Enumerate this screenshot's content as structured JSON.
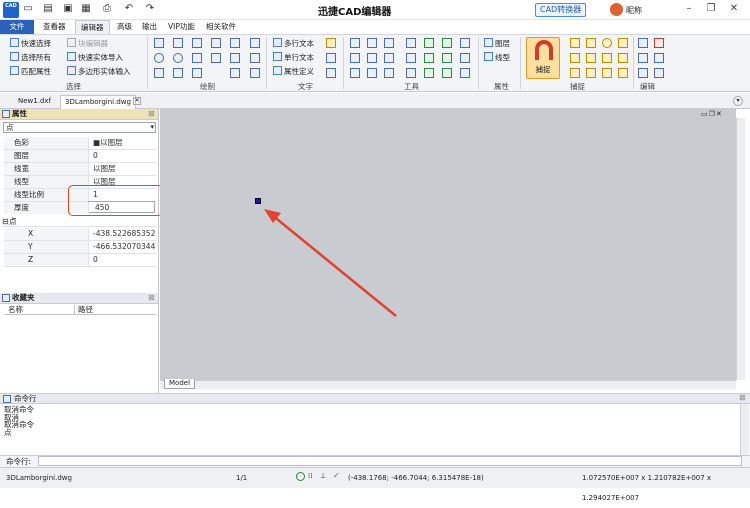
{
  "app": {
    "logo_text": "CAD",
    "title": "迅捷CAD编辑器",
    "cad_convert_label": "CAD转换器",
    "user_name": "昵称"
  },
  "quick_access": {
    "icons": [
      "new-icon",
      "open-icon",
      "save-icon",
      "saveas-icon",
      "print-icon",
      "undo-icon",
      "redo-icon"
    ]
  },
  "window_controls": {
    "minimize": "–",
    "restore": "❐",
    "close": "✕"
  },
  "ribbon_tabs": [
    "文件",
    "查看器",
    "编辑器",
    "高级",
    "输出",
    "VIP功能",
    "相关软件"
  ],
  "ribbon": {
    "select_group": {
      "label": "选择",
      "buttons": [
        "快速选择",
        "选择所有",
        "匹配属性"
      ]
    },
    "editor_group": {
      "buttons": [
        "块编辑器",
        "快速实体导入",
        "多边形实体输入"
      ]
    },
    "draw_group": {
      "label": "绘制"
    },
    "text_group": {
      "label": "文字",
      "buttons": [
        "多行文本",
        "单行文本",
        "属性定义"
      ]
    },
    "tools_group": {
      "label": "工具"
    },
    "props_group": {
      "label": "属性",
      "buttons": [
        "图层",
        "线型"
      ]
    },
    "snap_group": {
      "label": "捕捉",
      "button": "捕捉"
    },
    "edit_group": {
      "label": "编辑"
    }
  },
  "doc_tabs": [
    "New1.dxf",
    "3DLamborgini.dwg"
  ],
  "properties_panel": {
    "title": "属性",
    "selected_object": "点",
    "rows": [
      {
        "key": "色彩",
        "value": "■以图层"
      },
      {
        "key": "图层",
        "value": "0"
      },
      {
        "key": "线宽",
        "value": "以图层"
      },
      {
        "key": "线型",
        "value": "以图层"
      },
      {
        "key": "线型比例",
        "value": "1"
      },
      {
        "key": "厚度",
        "value": "450"
      }
    ],
    "point_section": "点",
    "point_rows": [
      {
        "key": "X",
        "value": "-438.522685352"
      },
      {
        "key": "Y",
        "value": "-466.532070344"
      },
      {
        "key": "Z",
        "value": "0"
      }
    ]
  },
  "favorites_panel": {
    "title": "收藏夹",
    "columns": [
      "名称",
      "路径"
    ]
  },
  "canvas": {
    "model_tab": "Model"
  },
  "command_panel": {
    "title": "命令行",
    "log": [
      "取消命令",
      "取消",
      "取消命令",
      "点"
    ],
    "input_label": "命令行:"
  },
  "status_bar": {
    "file": "3DLamborgini.dwg",
    "page": "1/1",
    "coords": "(-438.1768; -466.7044; 6.315478E-18)",
    "extents": "1.072570E+007 x 1.210782E+007 x 1.294027E+007"
  },
  "colors": {
    "accent": "#2b62b8",
    "highlight": "#e0442f",
    "canvas_bg": "#c8cbcf"
  }
}
